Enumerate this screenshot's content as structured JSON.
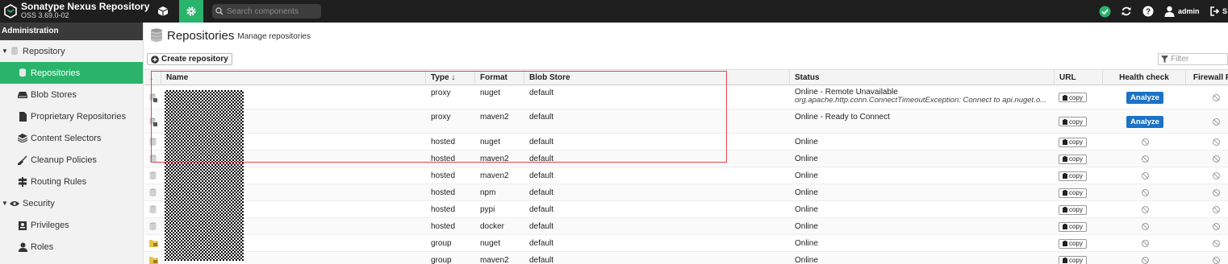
{
  "app": {
    "title": "Sonatype Nexus Repository",
    "version": "OSS 3.69.0-02"
  },
  "header": {
    "search_placeholder": "Search components",
    "user": "admin",
    "signout_label": "S"
  },
  "sidebar": {
    "header": "Administration",
    "items": [
      {
        "label": "Repository",
        "type": "group",
        "icon": "database-icon"
      },
      {
        "label": "Repositories",
        "type": "child",
        "active": true,
        "icon": "database-icon"
      },
      {
        "label": "Blob Stores",
        "type": "child",
        "icon": "hard-drive-icon"
      },
      {
        "label": "Proprietary Repositories",
        "type": "child",
        "icon": "document-icon"
      },
      {
        "label": "Content Selectors",
        "type": "child",
        "icon": "layers-icon"
      },
      {
        "label": "Cleanup Policies",
        "type": "child",
        "icon": "broom-icon"
      },
      {
        "label": "Routing Rules",
        "type": "child",
        "icon": "signpost-icon"
      },
      {
        "label": "Security",
        "type": "group",
        "icon": "eye-icon"
      },
      {
        "label": "Privileges",
        "type": "child",
        "icon": "badge-icon"
      },
      {
        "label": "Roles",
        "type": "child",
        "icon": "user-icon"
      }
    ]
  },
  "page": {
    "title": "Repositories",
    "subtitle": "Manage repositories",
    "create_label": "Create repository",
    "filter_placeholder": "Filter"
  },
  "table": {
    "columns": {
      "sort": "↓",
      "name": "Name",
      "type": "Type ↓",
      "format": "Format",
      "blob": "Blob Store",
      "status": "Status",
      "url": "URL",
      "health": "Health check",
      "firewall": "Firewall R"
    },
    "copy_label": "copy",
    "analyze_label": "Analyze",
    "rows": [
      {
        "type": "proxy",
        "format": "nuget",
        "blob": "default",
        "status": "Online - Remote Unavailable",
        "status_detail": "org.apache.http.conn.ConnectTimeoutException: Connect to api.nuget.o...",
        "health": "analyze",
        "icon": "proxy"
      },
      {
        "type": "proxy",
        "format": "maven2",
        "blob": "default",
        "status": "Online - Ready to Connect",
        "health": "analyze",
        "icon": "proxy"
      },
      {
        "type": "hosted",
        "format": "nuget",
        "blob": "default",
        "status": "Online",
        "health": "none",
        "icon": "hosted"
      },
      {
        "type": "hosted",
        "format": "maven2",
        "blob": "default",
        "status": "Online",
        "health": "none",
        "icon": "hosted"
      },
      {
        "type": "hosted",
        "format": "maven2",
        "blob": "default",
        "status": "Online",
        "health": "none",
        "icon": "hosted"
      },
      {
        "type": "hosted",
        "format": "npm",
        "blob": "default",
        "status": "Online",
        "health": "none",
        "icon": "hosted"
      },
      {
        "type": "hosted",
        "format": "pypi",
        "blob": "default",
        "status": "Online",
        "health": "none",
        "icon": "hosted"
      },
      {
        "type": "hosted",
        "format": "docker",
        "blob": "default",
        "status": "Online",
        "health": "none",
        "icon": "hosted"
      },
      {
        "type": "group",
        "format": "nuget",
        "blob": "default",
        "status": "Online",
        "health": "none",
        "icon": "group"
      },
      {
        "type": "group",
        "format": "maven2",
        "blob": "default",
        "status": "Online",
        "health": "none",
        "icon": "group"
      }
    ]
  },
  "colors": {
    "accent": "#2ab46b",
    "topbar": "#1e1e1e",
    "analyze": "#1b73c4",
    "highlight": "#e0474c"
  }
}
